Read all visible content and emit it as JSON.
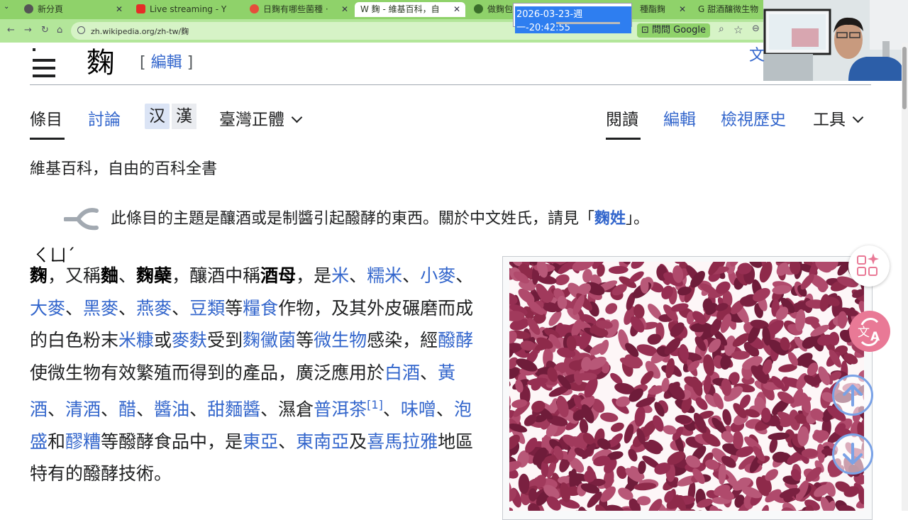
{
  "browser": {
    "tabs": [
      {
        "label": "新分頁",
        "icon": "chrome-icon"
      },
      {
        "label": "Live streaming - Y",
        "icon": "youtube-icon"
      },
      {
        "label": "日麴有哪些菌種 ·",
        "icon": "page-icon"
      },
      {
        "label": "W 麴 - 維基百科，自",
        "icon": "wikipedia-icon"
      },
      {
        "label": "做麴包",
        "icon": "page-icon"
      },
      {
        "label": "種酯麴",
        "icon": "page-icon"
      },
      {
        "label": "G 甜酒釀微生物",
        "icon": "google-icon"
      }
    ],
    "url": "zh.wikipedia.org/zh-tw/麴",
    "google_button": "問問 Google",
    "timestamp": "2026-03-23-週一-20:42:55"
  },
  "wiki": {
    "title": "麴",
    "edit_section": "編輯",
    "lang_button": "文",
    "tabs": {
      "article": "條目",
      "talk": "討論",
      "variant_simplified": "汉",
      "variant_traditional": "漢",
      "variant_select": "臺灣正體",
      "read": "閱讀",
      "edit": "編輯",
      "history": "檢視歷史",
      "tools": "工具"
    },
    "tagline": "維基百科，自由的百科全書",
    "hatnote": {
      "prefix": "此條目的主題是釀酒或是制醬引起醱酵的東西。關於中文姓氏，請見「",
      "link": "麴姓",
      "suffix": "」。"
    },
    "zhuyin": "ㄑㄩˊ"
  }
}
